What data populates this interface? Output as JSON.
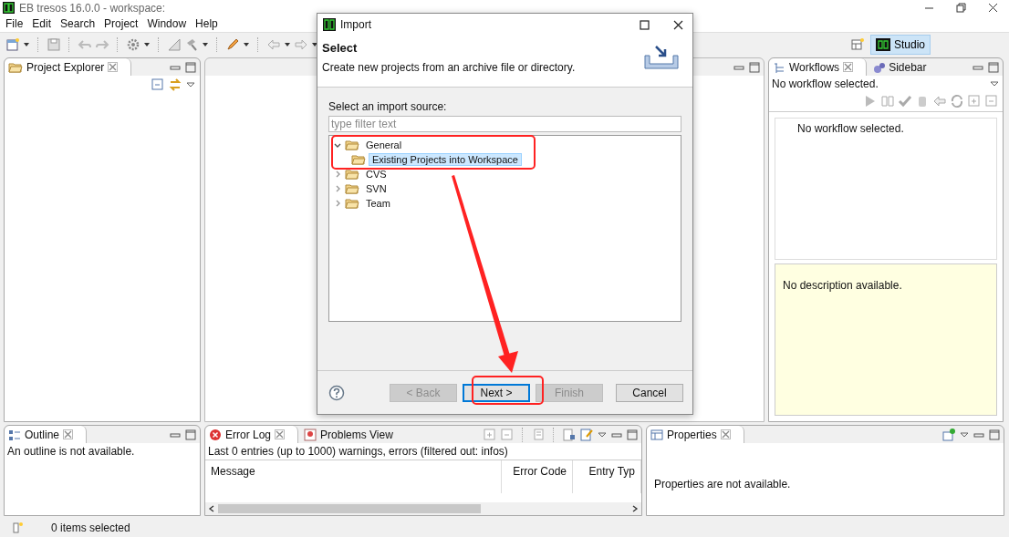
{
  "window": {
    "title": "EB tresos 16.0.0 - workspace:"
  },
  "menu": [
    "File",
    "Edit",
    "Search",
    "Project",
    "Window",
    "Help"
  ],
  "perspective": {
    "label": "Studio",
    "selected": true
  },
  "project_explorer": {
    "tab": "Project Explorer"
  },
  "workflows": {
    "tabs": [
      {
        "label": "Workflows",
        "selected": true
      },
      {
        "label": "Sidebar",
        "selected": false
      }
    ],
    "status": "No workflow selected.",
    "list_message": "No workflow selected.",
    "description": "No description available."
  },
  "outline": {
    "tab": "Outline",
    "message": "An outline is not available."
  },
  "error_log": {
    "tabs": [
      {
        "label": "Error Log",
        "selected": true
      },
      {
        "label": "Problems View",
        "selected": false
      }
    ],
    "summary": "Last 0 entries (up to 1000) warnings, errors (filtered out: infos)",
    "columns": [
      "Message",
      "Error Code",
      "Entry Typ"
    ]
  },
  "properties": {
    "tab": "Properties",
    "message": "Properties are not available."
  },
  "status_bar": {
    "text": "0 items selected"
  },
  "dialog": {
    "title": "Import",
    "heading": "Select",
    "description": "Create new projects from an archive file or directory.",
    "source_label": "Select an import source:",
    "filter": {
      "placeholder": "type filter text"
    },
    "tree": [
      {
        "label": "General",
        "expanded": true,
        "selected": false,
        "children": [
          {
            "label": "Existing Projects into Workspace",
            "selected": true
          }
        ]
      },
      {
        "label": "CVS",
        "expanded": false,
        "selected": false
      },
      {
        "label": "SVN",
        "expanded": false,
        "selected": false
      },
      {
        "label": "Team",
        "expanded": false,
        "selected": false
      }
    ],
    "buttons": [
      {
        "label": "< Back",
        "disabled": true,
        "focused": false
      },
      {
        "label": "Next >",
        "disabled": false,
        "focused": true
      },
      {
        "label": "Finish",
        "disabled": true,
        "focused": false
      },
      {
        "label": "Cancel",
        "disabled": false,
        "focused": false
      }
    ]
  }
}
